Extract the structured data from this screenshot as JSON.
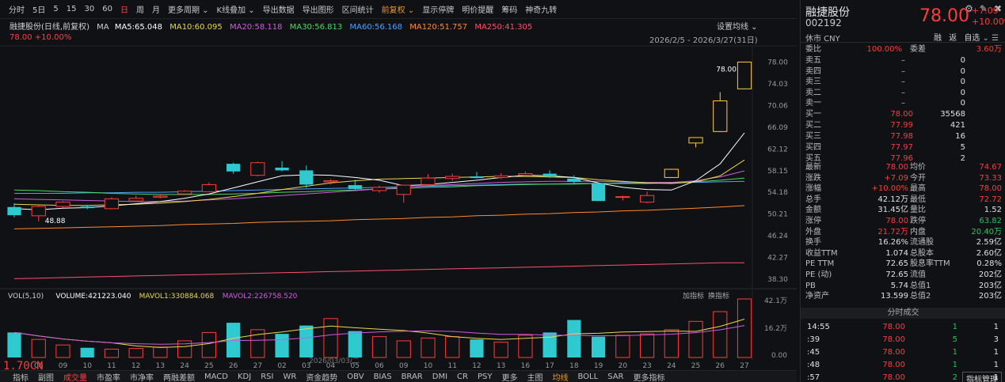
{
  "toolbar": {
    "items": [
      "分时",
      "5日",
      "5",
      "15",
      "30",
      "60",
      "日",
      "周",
      "月",
      "更多周期",
      "K线叠加",
      "导出数据",
      "导出图形",
      "区间统计",
      "前复权",
      "显示停牌",
      "明价提醒",
      "筹码",
      "神奇九转"
    ],
    "active_index": 6,
    "accent_index": 14,
    "right_icons": [
      "gear-icon",
      "pen-icon",
      "pin-icon"
    ]
  },
  "chart_info": {
    "title": "融捷股份(日线,前复权)",
    "ma_label": "MA",
    "ma5": "MA5:65.048",
    "ma10": "MA10:60.095",
    "ma20": "MA20:58.118",
    "ma30": "MA30:56.813",
    "ma60": "MA60:56.168",
    "ma120": "MA120:51.757",
    "ma250": "MA250:41.305",
    "last_info": "78.00  +10.00%",
    "date_range": "2026/2/5 - 2026/3/27(31日)",
    "settings": "设置均线"
  },
  "volume_info": {
    "vol_label": "VOL(5,10)",
    "volume": "VOLUME:421223.040",
    "mavol1": "MAVOL1:330884.068",
    "mavol2": "MAVOL2:226758.520",
    "buttons": [
      "加指标",
      "换指标"
    ],
    "axis": [
      "42.1万",
      "16.2万",
      "0.00"
    ],
    "date_tag": "2026/03/03/二"
  },
  "colors": {
    "up": "#ff3b3b",
    "down": "#2fc9d0",
    "ma5": "#ffffff",
    "ma10": "#e8d84a",
    "ma20": "#d15ae0",
    "ma30": "#4cd964",
    "ma60": "#4aa0ff",
    "ma120": "#ff8a2a",
    "ma250": "#ff4f6a"
  },
  "chart_data": {
    "type": "candlestick",
    "title": "融捷股份(日线,前复权)",
    "x": [
      "2026-02-05",
      "2026-02-06",
      "2026-02-09",
      "2026-02-10",
      "2026-02-11",
      "2026-02-12",
      "2026-02-13",
      "2026-02-24",
      "2026-02-25",
      "2026-02-26",
      "2026-02-27",
      "2026-03-02",
      "2026-03-03",
      "2026-03-04",
      "2026-03-05",
      "2026-03-06",
      "2026-03-09",
      "2026-03-10",
      "2026-03-11",
      "2026-03-12",
      "2026-03-13",
      "2026-03-16",
      "2026-03-17",
      "2026-03-18",
      "2026-03-19",
      "2026-03-20",
      "2026-03-23",
      "2026-03-24",
      "2026-03-25",
      "2026-03-26",
      "2026-03-27"
    ],
    "x_tick_labels": [
      "06",
      "09",
      "10",
      "11",
      "12",
      "13",
      "24",
      "25",
      "26",
      "27",
      "02",
      "03",
      "04",
      "05",
      "06",
      "09",
      "10",
      "11",
      "12",
      "13",
      "16",
      "17",
      "18",
      "19",
      "20",
      "23",
      "24",
      "25",
      "26",
      "27"
    ],
    "ohlc": [
      [
        51.5,
        52.2,
        49.6,
        50.0
      ],
      [
        49.9,
        51.8,
        48.88,
        51.6
      ],
      [
        51.6,
        52.6,
        51.3,
        52.4
      ],
      [
        51.6,
        51.9,
        51.1,
        51.3
      ],
      [
        51.2,
        53.3,
        51.1,
        53.0
      ],
      [
        52.6,
        53.6,
        52.5,
        53.1
      ],
      [
        53.3,
        53.9,
        53.1,
        53.5
      ],
      [
        53.9,
        54.6,
        53.8,
        54.4
      ],
      [
        54.3,
        56.0,
        54.2,
        55.6
      ],
      [
        59.4,
        59.6,
        57.6,
        58.0
      ],
      [
        57.3,
        59.8,
        57.1,
        59.6
      ],
      [
        58.7,
        59.9,
        58.0,
        58.2
      ],
      [
        58.2,
        59.1,
        55.0,
        55.6
      ],
      [
        56.1,
        56.6,
        55.6,
        56.3
      ],
      [
        55.5,
        56.5,
        54.6,
        54.8
      ],
      [
        54.5,
        55.4,
        54.1,
        55.1
      ],
      [
        53.8,
        55.5,
        52.3,
        55.5
      ],
      [
        55.6,
        57.5,
        55.3,
        56.8
      ],
      [
        56.7,
        57.6,
        56.3,
        57.1
      ],
      [
        57.1,
        57.9,
        56.7,
        56.8
      ],
      [
        56.9,
        57.7,
        56.6,
        57.2
      ],
      [
        57.3,
        58.0,
        57.2,
        57.6
      ],
      [
        57.6,
        58.2,
        56.8,
        57.1
      ],
      [
        56.7,
        57.3,
        55.9,
        56.1
      ],
      [
        55.9,
        55.9,
        52.6,
        52.6
      ],
      [
        53.4,
        53.6,
        52.7,
        53.4
      ],
      [
        52.4,
        54.3,
        52.2,
        53.6
      ],
      [
        56.9,
        58.5,
        56.8,
        58.4
      ],
      [
        63.2,
        64.0,
        62.4,
        64.2
      ],
      [
        65.3,
        72.5,
        65.2,
        70.9
      ],
      [
        73.1,
        78.0,
        73.0,
        78.0
      ]
    ],
    "ylim": [
      37.3,
      79.8
    ],
    "y_ticks": [
      78.0,
      74.03,
      70.06,
      66.09,
      62.12,
      58.15,
      54.18,
      50.21,
      46.24,
      42.27,
      38.3
    ],
    "annotations": {
      "high": "78.00",
      "low": "48.88"
    },
    "ma5": [
      51.2,
      51.0,
      51.3,
      51.4,
      51.7,
      52.1,
      52.5,
      53.1,
      53.9,
      55.0,
      56.1,
      57.2,
      57.4,
      57.3,
      56.9,
      56.4,
      55.4,
      55.6,
      56.0,
      56.4,
      56.9,
      57.3,
      57.2,
      56.9,
      55.9,
      55.1,
      54.7,
      54.6,
      56.3,
      59.4,
      65.05
    ],
    "ma10": [
      52.0,
      51.9,
      51.8,
      51.8,
      51.9,
      52.0,
      52.2,
      52.5,
      52.9,
      53.4,
      54.0,
      54.7,
      55.3,
      55.9,
      56.3,
      56.6,
      56.7,
      56.8,
      56.9,
      57.0,
      57.1,
      57.1,
      57.0,
      56.9,
      56.5,
      56.2,
      55.9,
      55.8,
      56.1,
      57.2,
      60.1
    ],
    "ma20": [
      53.0,
      52.9,
      52.8,
      52.7,
      52.6,
      52.5,
      52.5,
      52.6,
      52.8,
      53.0,
      53.3,
      53.6,
      53.9,
      54.2,
      54.5,
      54.8,
      55.1,
      55.4,
      55.6,
      55.8,
      56.0,
      56.1,
      56.2,
      56.2,
      56.2,
      56.1,
      56.0,
      56.0,
      56.3,
      57.0,
      58.1
    ],
    "ma30": [
      54.6,
      54.5,
      54.3,
      54.2,
      54.0,
      53.9,
      53.8,
      53.8,
      53.8,
      53.9,
      54.0,
      54.2,
      54.3,
      54.5,
      54.6,
      54.8,
      54.9,
      55.1,
      55.2,
      55.4,
      55.5,
      55.6,
      55.7,
      55.7,
      55.8,
      55.8,
      55.8,
      55.9,
      56.1,
      56.4,
      56.8
    ],
    "ma60": [
      54.0,
      54.0,
      54.0,
      54.1,
      54.1,
      54.2,
      54.2,
      54.3,
      54.4,
      54.5,
      54.6,
      54.7,
      54.8,
      54.9,
      55.0,
      55.1,
      55.2,
      55.3,
      55.4,
      55.5,
      55.6,
      55.7,
      55.7,
      55.8,
      55.8,
      55.9,
      55.9,
      56.0,
      56.0,
      56.1,
      56.2
    ],
    "ma120": [
      47.5,
      47.6,
      47.7,
      47.8,
      47.9,
      48.0,
      48.1,
      48.3,
      48.4,
      48.5,
      48.7,
      48.8,
      48.9,
      49.0,
      49.2,
      49.3,
      49.4,
      49.6,
      49.7,
      49.9,
      50.0,
      50.2,
      50.3,
      50.5,
      50.6,
      50.8,
      50.9,
      51.1,
      51.3,
      51.5,
      51.76
    ],
    "ma250": [
      38.4,
      38.5,
      38.6,
      38.7,
      38.8,
      38.9,
      39.0,
      39.1,
      39.2,
      39.3,
      39.4,
      39.5,
      39.6,
      39.7,
      39.8,
      39.9,
      40.0,
      40.1,
      40.2,
      40.3,
      40.4,
      40.5,
      40.6,
      40.7,
      40.8,
      40.9,
      41.0,
      41.1,
      41.2,
      41.3,
      41.3
    ],
    "volume": [
      180000,
      130000,
      90000,
      70000,
      60000,
      65000,
      75000,
      120000,
      180000,
      250000,
      200000,
      170000,
      230000,
      280000,
      190000,
      150000,
      120000,
      140000,
      150000,
      130000,
      110000,
      160000,
      180000,
      270000,
      150000,
      160000,
      170000,
      200000,
      260000,
      330000,
      421223
    ],
    "vol_ylim": [
      0,
      421223
    ]
  },
  "right_panel": {
    "name": "融捷股份",
    "code": "002192",
    "price": "78.00",
    "change": "+7.09",
    "change_pct": "+10.00%",
    "market": "休市 CNY",
    "icons": [
      "融",
      "返",
      "自选"
    ],
    "webi": {
      "label": "委比",
      "value": "100.00%",
      "label2": "委差",
      "value2": "3.60万"
    },
    "asks": [
      {
        "label": "卖五",
        "price": "–",
        "vol": "0"
      },
      {
        "label": "卖四",
        "price": "–",
        "vol": "0"
      },
      {
        "label": "卖三",
        "price": "–",
        "vol": "0"
      },
      {
        "label": "卖二",
        "price": "–",
        "vol": "0"
      },
      {
        "label": "卖一",
        "price": "–",
        "vol": "0"
      }
    ],
    "bids": [
      {
        "label": "买一",
        "price": "78.00",
        "vol": "35568"
      },
      {
        "label": "买二",
        "price": "77.99",
        "vol": "421"
      },
      {
        "label": "买三",
        "price": "77.98",
        "vol": "16"
      },
      {
        "label": "买四",
        "price": "77.97",
        "vol": "5"
      },
      {
        "label": "买五",
        "price": "77.96",
        "vol": "2"
      }
    ],
    "stats": [
      {
        "l1": "最新",
        "v1": "78.00",
        "c1": "red",
        "l2": "均价",
        "v2": "74.67",
        "c2": "red"
      },
      {
        "l1": "涨跌",
        "v1": "+7.09",
        "c1": "red",
        "l2": "今开",
        "v2": "73.33",
        "c2": "red"
      },
      {
        "l1": "涨幅",
        "v1": "+10.00%",
        "c1": "red",
        "l2": "最高",
        "v2": "78.00",
        "c2": "red"
      },
      {
        "l1": "总手",
        "v1": "42.12万",
        "c1": "white",
        "l2": "最低",
        "v2": "72.72",
        "c2": "red"
      },
      {
        "l1": "金额",
        "v1": "31.45亿",
        "c1": "white",
        "l2": "量比",
        "v2": "1.52",
        "c2": "white"
      },
      {
        "l1": "涨停",
        "v1": "78.00",
        "c1": "red",
        "l2": "跌停",
        "v2": "63.82",
        "c2": "green"
      },
      {
        "l1": "外盘",
        "v1": "21.72万",
        "c1": "red",
        "l2": "内盘",
        "v2": "20.40万",
        "c2": "green"
      },
      {
        "l1": "换手",
        "v1": "16.26%",
        "c1": "white",
        "l2": "流通股",
        "v2": "2.59亿",
        "c2": "white"
      },
      {
        "l1": "收益TTM",
        "v1": "1.074",
        "c1": "white",
        "l2": "总股本",
        "v2": "2.60亿",
        "c2": "white"
      },
      {
        "l1": "PE TTM",
        "v1": "72.65",
        "c1": "white",
        "l2": "股息率TTM",
        "v2": "0.28%",
        "c2": "white"
      },
      {
        "l1": "PE (动)",
        "v1": "72.65",
        "c1": "white",
        "l2": "流值",
        "v2": "202亿",
        "c2": "white"
      },
      {
        "l1": "PB",
        "v1": "5.74",
        "c1": "white",
        "l2": "总值1",
        "v2": "203亿",
        "c2": "white"
      },
      {
        "l1": "净资产",
        "v1": "13.599",
        "c1": "white",
        "l2": "总值2",
        "v2": "203亿",
        "c2": "white"
      }
    ],
    "trades_header": "分时成交",
    "trades": [
      {
        "time": "14:55",
        "price": "78.00",
        "vol": "1",
        "n": "1"
      },
      {
        "time": ":39",
        "price": "78.00",
        "vol": "5",
        "n": "3"
      },
      {
        "time": ":45",
        "price": "78.00",
        "vol": "1",
        "n": "1"
      },
      {
        "time": ":48",
        "price": "78.00",
        "vol": "1",
        "n": "1"
      },
      {
        "time": ":57",
        "price": "78.00",
        "vol": "2",
        "n": "1"
      }
    ]
  },
  "bottombar": {
    "items": [
      "指标",
      "副图",
      "成交量",
      "市盈率",
      "市净率",
      "两融差额",
      "MACD",
      "KDJ",
      "RSI",
      "WR",
      "资金趋势",
      "OBV",
      "BIAS",
      "BRAR",
      "DMI",
      "CR",
      "PSY",
      "更多",
      "主图",
      "均线",
      "BOLL",
      "SAR",
      "更多指标"
    ],
    "active_index": 2,
    "accent_index": 19,
    "manager": "指标管理"
  },
  "corner_mark": "1.70CN"
}
